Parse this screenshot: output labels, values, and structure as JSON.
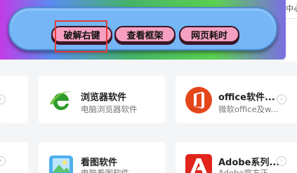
{
  "toolbar": {
    "buttons": [
      {
        "label": "破解右键"
      },
      {
        "label": "查看框架"
      },
      {
        "label": "网页耗时"
      }
    ]
  },
  "right_edge": {
    "text": "中心"
  },
  "cards": [
    {
      "title": "浏览器软件",
      "desc": "电脑浏览器软件",
      "icon": "green-e-browser-icon"
    },
    {
      "title": "office软件...",
      "desc": "微软office及w...",
      "icon": "office-icon"
    },
    {
      "title": "看图软件",
      "desc": "电脑看图软件",
      "icon": "image-viewer-icon"
    },
    {
      "title": "Adobe系列...",
      "desc": "Adobe官方正...",
      "icon": "adobe-icon"
    }
  ],
  "colors": {
    "toolbar_pill": "#74b6f6",
    "button_fill": "#f5a0c0",
    "highlight": "#e53935",
    "office_orange": "#e4461b",
    "adobe_red": "#e1251b"
  }
}
